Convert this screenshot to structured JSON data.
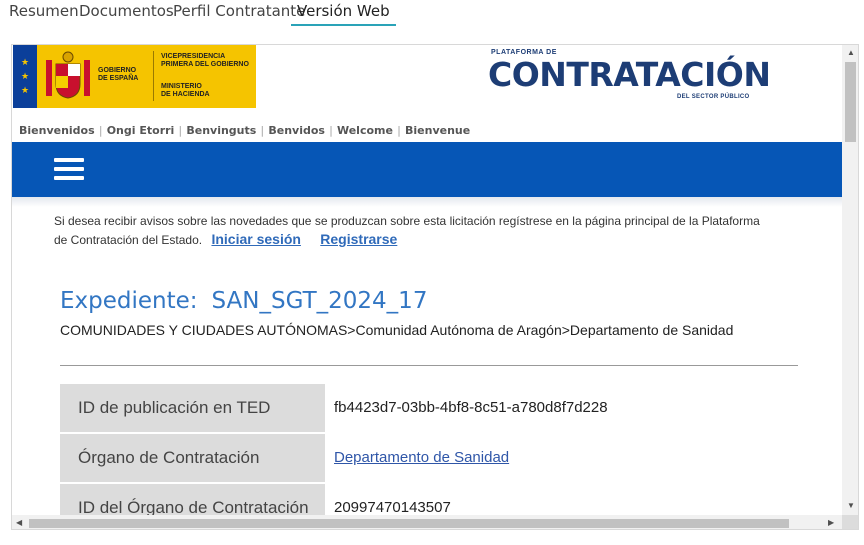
{
  "tabs": [
    {
      "label": "Resumen"
    },
    {
      "label": "Documentos"
    },
    {
      "label": "Perfil Contratante"
    },
    {
      "label": "Versión Web"
    }
  ],
  "header": {
    "gov_line1": "GOBIERNO",
    "gov_line2": "DE ESPAÑA",
    "vice_line1": "VICEPRESIDENCIA",
    "vice_line2": "PRIMERA DEL GOBIERNO",
    "min_line1": "MINISTERIO",
    "min_line2": "DE HACIENDA",
    "plat_small": "PLATAFORMA DE",
    "plat_big": "CONTRATACIÓN",
    "plat_sub": "DEL SECTOR PÚBLICO"
  },
  "langs": [
    "Bienvenidos",
    "Ongi Etorri",
    "Benvinguts",
    "Benvidos",
    "Welcome",
    "Bienvenue"
  ],
  "notice": {
    "text": "Si desea recibir avisos sobre las novedades que se produzcan sobre esta licitación regístrese en la página principal de la Plataforma de Contratación del Estado.",
    "login": "Iniciar sesión",
    "register": "Registrarse"
  },
  "expediente": {
    "label": "Expediente:",
    "value": "SAN_SGT_2024_17",
    "breadcrumb": "COMUNIDADES Y CIUDADES AUTÓNOMAS>Comunidad Autónoma de Aragón>Departamento de Sanidad"
  },
  "details": [
    {
      "key": "ID de publicación en TED",
      "value": "fb4423d7-03bb-4bf8-8c51-a780d8f7d228"
    },
    {
      "key": "Órgano de Contratación",
      "value": "Departamento de Sanidad"
    },
    {
      "key": "ID del Órgano de Contratación",
      "value": "20997470143507"
    }
  ],
  "colors": {
    "accent_tab": "#2aa3b8",
    "blue_bar": "#0656b6",
    "gov_yellow": "#f5c400",
    "title_blue": "#3276c3"
  }
}
